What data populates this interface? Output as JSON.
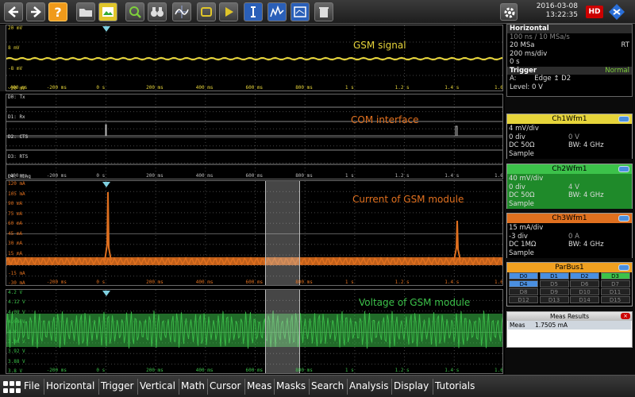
{
  "toolbar": {
    "buttons": [
      "back-icon",
      "forward-icon",
      "help-icon",
      "open-folder-icon",
      "photo-icon",
      "zoom-icon",
      "binoculars-icon",
      "fft-icon",
      "chip-icon",
      "play-icon",
      "bus-icon",
      "spectrum-icon",
      "mask-icon",
      "trash-icon"
    ],
    "date": "2016-03-08",
    "time": "13:22:35",
    "hd_label": "HD"
  },
  "colors": {
    "ch1": "#e6d43a",
    "ch2": "#3cc24a",
    "ch3": "#e0701f",
    "parbus": "#f0a020",
    "trigger": "#7fd0e0",
    "grid": "#454545"
  },
  "panels": {
    "gsm": {
      "title": "GSM signal",
      "y_labels": [
        "20 mV",
        "8 mV",
        "-8 mV",
        "-20 mV"
      ],
      "x_labels": [
        "-200 ms",
        "0 s",
        "200 ms",
        "400 ms",
        "600 ms",
        "800 ms",
        "1 s",
        "1.2 s",
        "1.4 s",
        "1.6 s"
      ],
      "left_x_label": "-400 ms"
    },
    "com": {
      "title": "COM interface",
      "y_labels": [
        "D0: Tx",
        "D1: Rx",
        "D2: CTS",
        "D3: RTS",
        "D4: Ring"
      ],
      "x_labels": [
        "-200 ms",
        "0 s",
        "200 ms",
        "400 ms",
        "600 ms",
        "800 ms",
        "1 s",
        "1.2 s",
        "1.4 s",
        "1.6 s"
      ],
      "left_x_label": "-400 ms"
    },
    "current": {
      "title": "Current of GSM module",
      "y_labels": [
        "120 mA",
        "105 mA",
        "90 mA",
        "75 mA",
        "60 mA",
        "45 mA",
        "30 mA",
        "15 mA",
        "0 A",
        "-15 mA",
        "-30 mA"
      ],
      "x_labels": [
        "-200 ms",
        "0 s",
        "200 ms",
        "400 ms",
        "600 ms",
        "800 ms",
        "1 s",
        "1.2 s",
        "1.4 s",
        "1.6 s"
      ]
    },
    "voltage": {
      "title": "Voltage of GSM module",
      "y_labels": [
        "4.2 V",
        "4.12 V",
        "4.08 V",
        "4.04 V",
        "4 V",
        "3.96 V",
        "3.92 V",
        "3.88 V",
        "3.8 V"
      ],
      "x_labels": [
        "-200 ms",
        "0 s",
        "200 ms",
        "400 ms",
        "600 ms",
        "800 ms",
        "1 s",
        "1.2 s",
        "1.4 s",
        "1.6 s"
      ]
    }
  },
  "horizontal": {
    "title": "Horizontal",
    "row1": "100 ns / 10 MSa/s",
    "row2": "20 MSa",
    "row2_right": "RT",
    "row3": "200 ms/div",
    "row4": "0 s",
    "trigger_title": "Trigger",
    "trigger_mode": "Normal",
    "trigger_source_label": "A:",
    "trigger_type": "Edge",
    "trigger_channel": "D2",
    "trigger_level": "Level: 0 V"
  },
  "waveforms": [
    {
      "name": "Ch1Wfm1",
      "scale": "4 mV/div",
      "pos": "0 div",
      "offset": "0 V",
      "coupling": "DC 50Ω",
      "bw": "BW: 4 GHz",
      "acq": "Sample"
    },
    {
      "name": "Ch2Wfm1",
      "scale": "40 mV/div",
      "pos": "0 div",
      "offset": "4 V",
      "coupling": "DC 50Ω",
      "bw": "BW: 4 GHz",
      "acq": "Sample"
    },
    {
      "name": "Ch3Wfm1",
      "scale": "15 mA/div",
      "pos": "-3 div",
      "offset": "0 A",
      "coupling": "DC 1MΩ",
      "bw": "BW: 4 GHz",
      "acq": "Sample"
    }
  ],
  "parbus": {
    "name": "ParBus1",
    "bits": [
      "D0",
      "D1",
      "D2",
      "D3",
      "D4",
      "D5",
      "D6",
      "D7",
      "D8",
      "D9",
      "D10",
      "D11",
      "D12",
      "D13",
      "D14",
      "D15"
    ]
  },
  "meas": {
    "title": "Meas Results",
    "label": "Meas",
    "value": "1.7505 mA",
    "close": "×"
  },
  "menu": [
    "File",
    "Horizontal",
    "Trigger",
    "Vertical",
    "Math",
    "Cursor",
    "Meas",
    "Masks",
    "Search",
    "Analysis",
    "Display",
    "Tutorials"
  ]
}
